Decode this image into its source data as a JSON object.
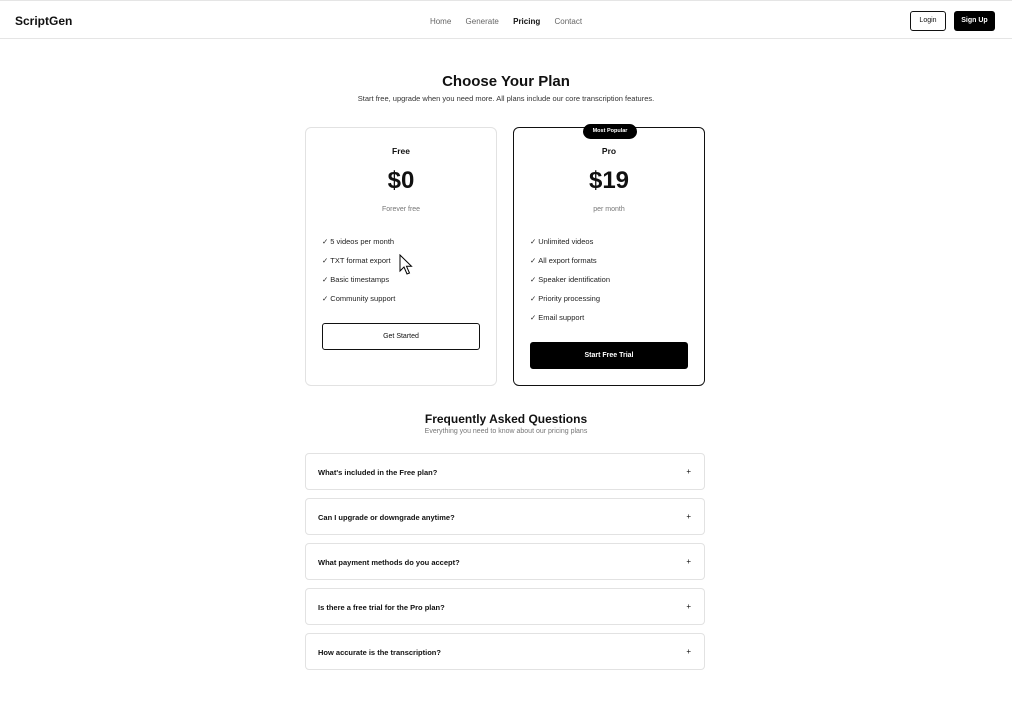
{
  "header": {
    "brand": "ScriptGen",
    "nav": [
      "Home",
      "Generate",
      "Pricing",
      "Contact"
    ],
    "active_nav": "Pricing",
    "login_label": "Login",
    "signup_label": "Sign Up"
  },
  "hero": {
    "title": "Choose Your Plan",
    "subtitle": "Start free, upgrade when you need more. All plans include our core transcription features."
  },
  "plans": [
    {
      "name": "Free",
      "price": "$0",
      "period": "Forever free",
      "features": [
        "5 videos per month",
        "TXT format export",
        "Basic timestamps",
        "Community support"
      ],
      "cta": "Get Started"
    },
    {
      "name": "Pro",
      "badge": "Most Popular",
      "price": "$19",
      "period": "per month",
      "features": [
        "Unlimited videos",
        "All export formats",
        "Speaker identification",
        "Priority processing",
        "Email support"
      ],
      "cta": "Start Free Trial"
    }
  ],
  "check_glyph": "✓",
  "faq": {
    "title": "Frequently Asked Questions",
    "subtitle": "Everything you need to know about our pricing plans",
    "expand_glyph": "+",
    "items": [
      "What's included in the Free plan?",
      "Can I upgrade or downgrade anytime?",
      "What payment methods do you accept?",
      "Is there a free trial for the Pro plan?",
      "How accurate is the transcription?"
    ]
  },
  "colors": {
    "accent": "#000000",
    "border": "#e2e2e2",
    "muted_text": "#777777"
  }
}
